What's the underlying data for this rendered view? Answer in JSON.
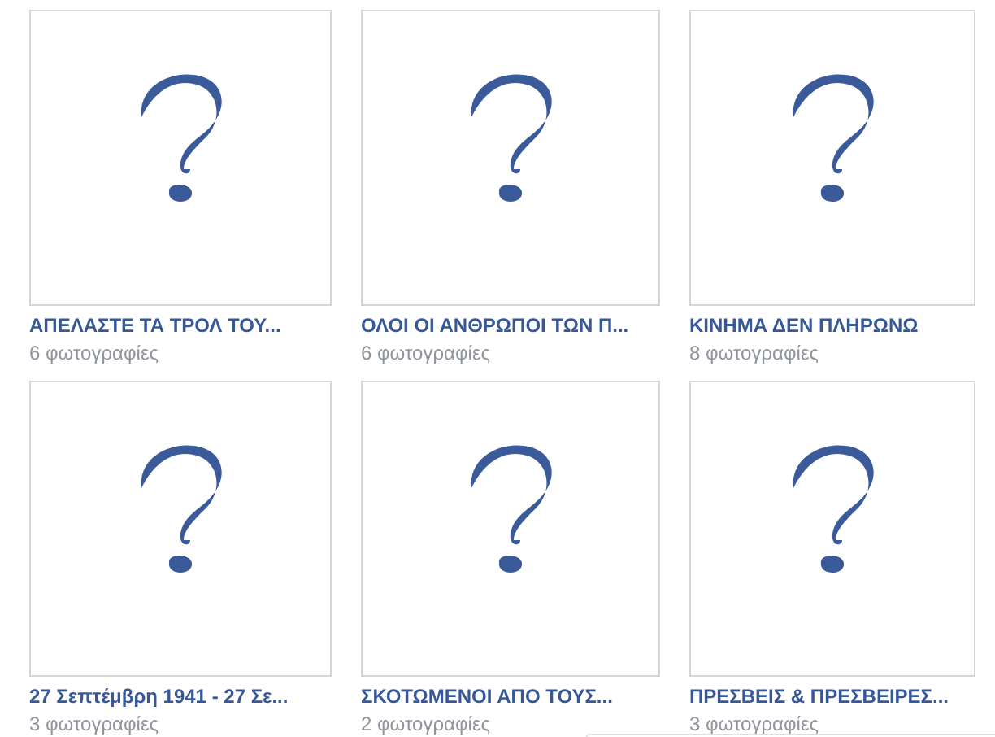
{
  "albums": [
    {
      "title": "ΑΠΕΛΑΣΤΕ ΤΑ ΤΡΟΛ ΤΟΥ...",
      "count": "6 φωτογραφίες"
    },
    {
      "title": "ΟΛΟΙ ΟΙ ΑΝΘΡΩΠΟΙ ΤΩΝ Π...",
      "count": "6 φωτογραφίες"
    },
    {
      "title": "ΚΙΝΗΜΑ ΔΕΝ ΠΛΗΡΩΝΩ",
      "count": "8 φωτογραφίες"
    },
    {
      "title": "27 Σεπτέμβρη 1941 - 27 Σε...",
      "count": "3 φωτογραφίες"
    },
    {
      "title": "ΣΚΟΤΩΜΕΝΟΙ ΑΠΟ ΤΟΥΣ...",
      "count": "2 φωτογραφίες"
    },
    {
      "title": "ΠΡΕΣΒΕΙΣ & ΠΡΕΣΒΕΙΡΕΣ...",
      "count": "3 φωτογραφίες"
    }
  ]
}
